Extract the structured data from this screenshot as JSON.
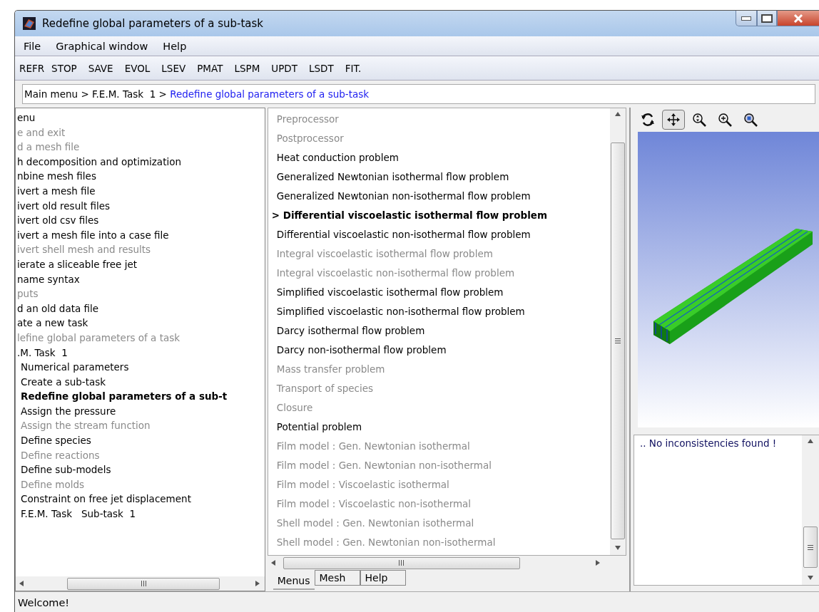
{
  "window": {
    "title": "Redefine global parameters of a sub-task"
  },
  "menu_bar": [
    "File",
    "Graphical window",
    "Help"
  ],
  "toolbar": [
    "REFR",
    "STOP",
    "SAVE",
    "EVOL",
    "LSEV",
    "PMAT",
    "LSPM",
    "UPDT",
    "LSDT",
    "FIT."
  ],
  "breadcrumb": {
    "path": "Main menu > F.E.M. Task  1 > ",
    "current": "Redefine global parameters of a sub-task"
  },
  "tree": [
    {
      "label": "enu",
      "disabled": false,
      "selected": false
    },
    {
      "label": "e and exit",
      "disabled": true,
      "selected": false
    },
    {
      "label": "d a mesh file",
      "disabled": true,
      "selected": false
    },
    {
      "label": "h decomposition and optimization",
      "disabled": false,
      "selected": false
    },
    {
      "label": "nbine mesh files",
      "disabled": false,
      "selected": false
    },
    {
      "label": "ivert a mesh file",
      "disabled": false,
      "selected": false
    },
    {
      "label": "ivert old result files",
      "disabled": false,
      "selected": false
    },
    {
      "label": "ivert old csv files",
      "disabled": false,
      "selected": false
    },
    {
      "label": "ivert a mesh file into a case file",
      "disabled": false,
      "selected": false
    },
    {
      "label": "ivert shell mesh and results",
      "disabled": true,
      "selected": false
    },
    {
      "label": "ierate a sliceable free jet",
      "disabled": false,
      "selected": false
    },
    {
      "label": "name syntax",
      "disabled": false,
      "selected": false
    },
    {
      "label": "puts",
      "disabled": true,
      "selected": false
    },
    {
      "label": "d an old data file",
      "disabled": false,
      "selected": false
    },
    {
      "label": "ate a new task",
      "disabled": false,
      "selected": false
    },
    {
      "label": "lefine global parameters of a task",
      "disabled": true,
      "selected": false
    },
    {
      "label": ".M. Task  1",
      "disabled": false,
      "selected": false,
      "children": [
        {
          "label": "Numerical parameters",
          "disabled": false,
          "selected": false
        },
        {
          "label": "Create a sub-task",
          "disabled": false,
          "selected": false
        },
        {
          "label": "Redefine global parameters of a sub-t",
          "disabled": false,
          "selected": true
        },
        {
          "label": "Assign the pressure",
          "disabled": false,
          "selected": false
        },
        {
          "label": "Assign the stream function",
          "disabled": true,
          "selected": false
        },
        {
          "label": "Define species",
          "disabled": false,
          "selected": false
        },
        {
          "label": "Define reactions",
          "disabled": true,
          "selected": false
        },
        {
          "label": "Define sub-models",
          "disabled": false,
          "selected": false
        },
        {
          "label": "Define molds",
          "disabled": true,
          "selected": false
        },
        {
          "label": "Constraint on free jet displacement",
          "disabled": false,
          "selected": false
        },
        {
          "label": "F.E.M. Task   Sub-task  1",
          "disabled": false,
          "selected": false
        }
      ]
    }
  ],
  "problems": [
    {
      "label": "Preprocessor",
      "disabled": true,
      "selected": false
    },
    {
      "label": "Postprocessor",
      "disabled": true,
      "selected": false
    },
    {
      "label": "Heat conduction problem",
      "disabled": false,
      "selected": false
    },
    {
      "label": "Generalized Newtonian isothermal flow problem",
      "disabled": false,
      "selected": false
    },
    {
      "label": "Generalized Newtonian non-isothermal flow problem",
      "disabled": false,
      "selected": false
    },
    {
      "label": "> Differential viscoelastic isothermal flow problem",
      "disabled": false,
      "selected": true
    },
    {
      "label": "Differential viscoelastic non-isothermal flow problem",
      "disabled": false,
      "selected": false
    },
    {
      "label": "Integral viscoelastic isothermal flow problem",
      "disabled": true,
      "selected": false
    },
    {
      "label": "Integral viscoelastic non-isothermal flow problem",
      "disabled": true,
      "selected": false
    },
    {
      "label": "Simplified viscoelastic isothermal flow problem",
      "disabled": false,
      "selected": false
    },
    {
      "label": "Simplified viscoelastic non-isothermal flow problem",
      "disabled": false,
      "selected": false
    },
    {
      "label": "Darcy isothermal flow problem",
      "disabled": false,
      "selected": false
    },
    {
      "label": "Darcy non-isothermal flow problem",
      "disabled": false,
      "selected": false
    },
    {
      "label": "Mass transfer problem",
      "disabled": true,
      "selected": false
    },
    {
      "label": "Transport of species",
      "disabled": true,
      "selected": false
    },
    {
      "label": "Closure",
      "disabled": true,
      "selected": false
    },
    {
      "label": "Potential problem",
      "disabled": false,
      "selected": false
    },
    {
      "label": "Film model : Gen. Newtonian isothermal",
      "disabled": true,
      "selected": false
    },
    {
      "label": "Film model : Gen. Newtonian non-isothermal",
      "disabled": true,
      "selected": false
    },
    {
      "label": "Film model : Viscoelastic isothermal",
      "disabled": true,
      "selected": false
    },
    {
      "label": "Film model : Viscoelastic non-isothermal",
      "disabled": true,
      "selected": false
    },
    {
      "label": "Shell model : Gen. Newtonian isothermal",
      "disabled": true,
      "selected": false
    },
    {
      "label": "Shell model : Gen. Newtonian non-isothermal",
      "disabled": true,
      "selected": false
    }
  ],
  "tabs": [
    {
      "label": "Menus",
      "selected": true
    },
    {
      "label": "Mesh",
      "selected": false
    },
    {
      "label": "Help",
      "selected": false
    }
  ],
  "view_tools": [
    {
      "kind": "rotate",
      "selected": false
    },
    {
      "kind": "pan",
      "selected": true
    },
    {
      "kind": "zoom-drag",
      "selected": false
    },
    {
      "kind": "zoom-in",
      "selected": false
    },
    {
      "kind": "zoom-fit",
      "selected": false
    }
  ],
  "console": {
    "text": ".. No inconsistencies found !"
  },
  "status_bar": "Welcome!"
}
